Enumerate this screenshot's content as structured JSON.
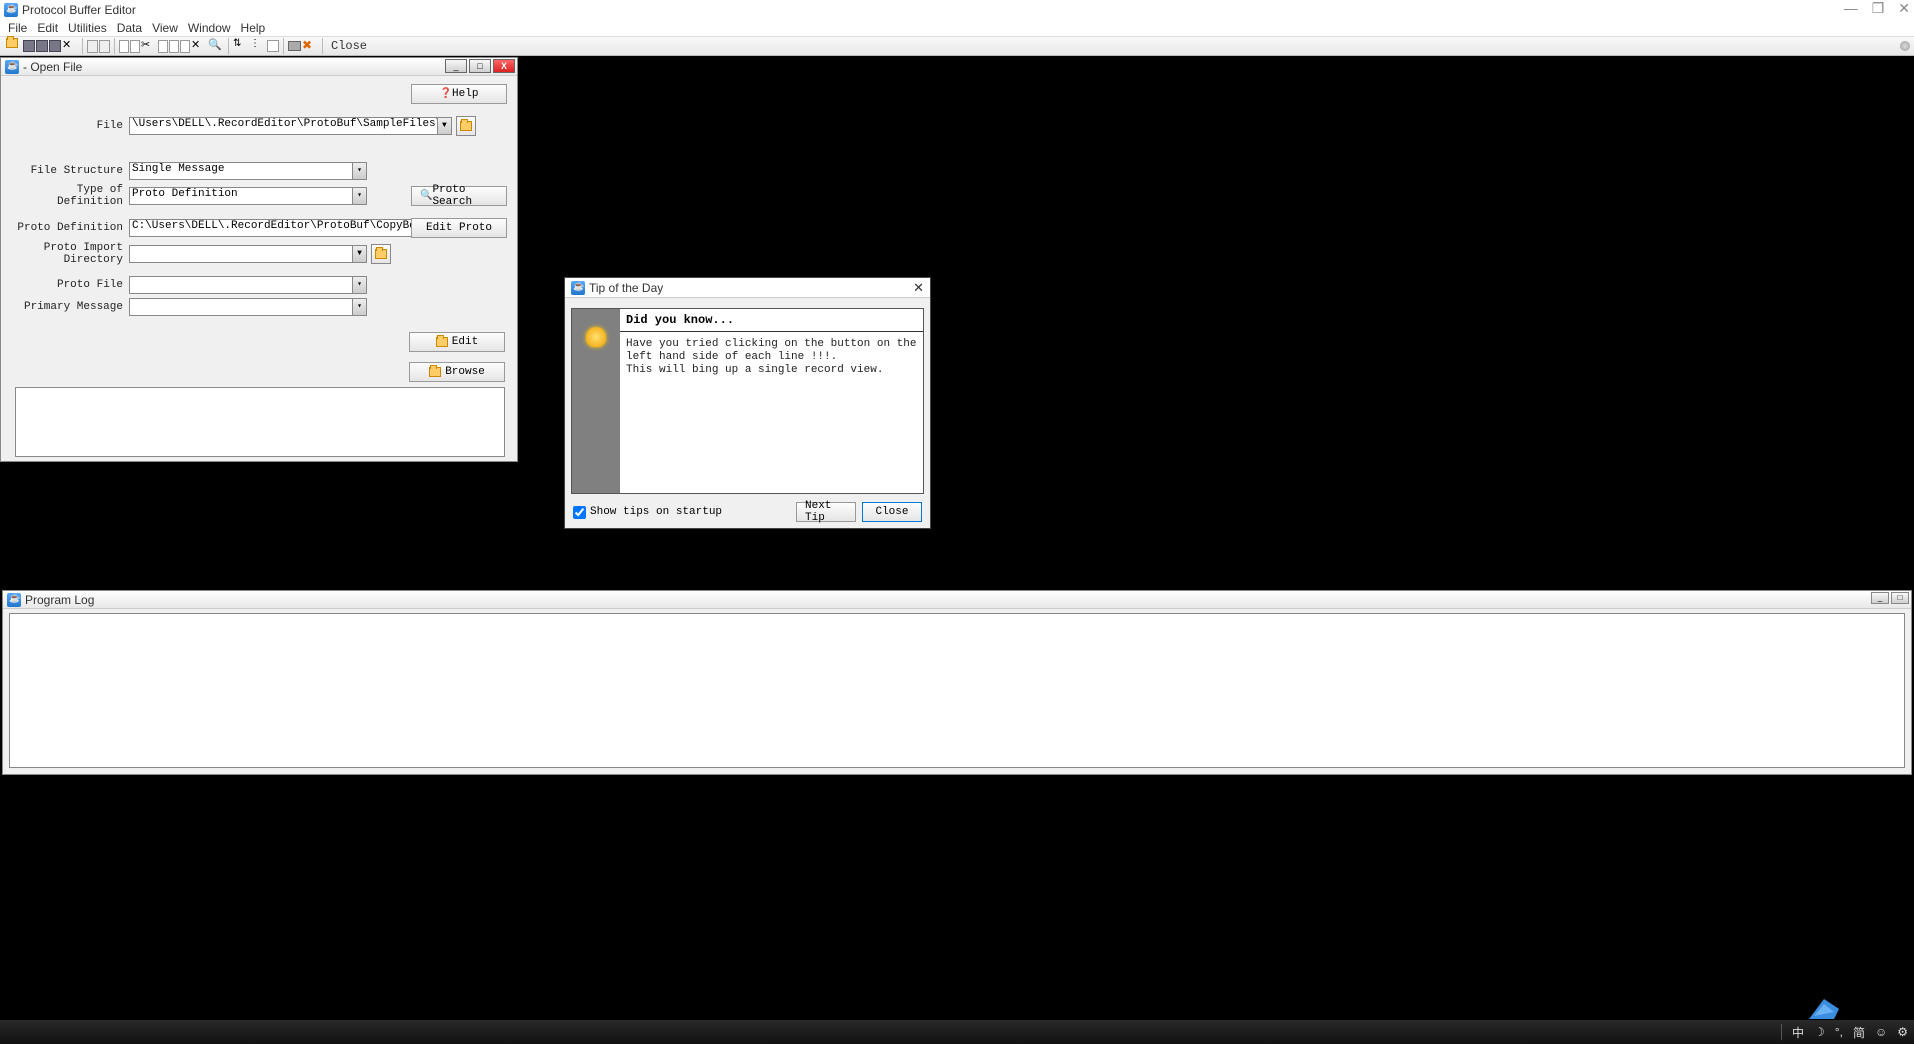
{
  "app": {
    "title": "Protocol Buffer Editor"
  },
  "menu": {
    "file": "File",
    "edit": "Edit",
    "utilities": "Utilities",
    "data": "Data",
    "view": "View",
    "window": "Window",
    "help": "Help"
  },
  "toolbar": {
    "close": "Close"
  },
  "open_file": {
    "title": " - Open File",
    "help": "Help",
    "labels": {
      "file": "File",
      "file_structure": "File Structure",
      "type_of_def": "Type of Definition",
      "proto_def": "Proto Definition",
      "proto_import": "Proto Import Directory",
      "proto_file": "Proto File",
      "primary_msg": "Primary Message"
    },
    "values": {
      "file": "\\Users\\DELL\\.RecordEditor\\ProtoBuf\\SampleFiles\\*",
      "file_structure": "Single Message",
      "type_of_def": "Proto Definition",
      "proto_def": "C:\\Users\\DELL\\.RecordEditor\\ProtoBuf\\CopyBook\\*",
      "proto_import": "",
      "proto_file": "",
      "primary_msg": ""
    },
    "buttons": {
      "proto_search": "Proto Search",
      "edit_proto": "Edit Proto",
      "edit": "Edit",
      "browse": "Browse"
    }
  },
  "tip": {
    "title": "Tip of the Day",
    "header": "Did you know...",
    "body_line1": "Have you tried clicking on the button on the left hand side of each line !!!.",
    "body_line2": "This will bing up a single record view.",
    "show_on_startup": "Show tips on startup",
    "next_tip": "Next Tip",
    "close": "Close"
  },
  "program_log": {
    "title": "Program Log"
  },
  "tray": {
    "ime1": "中",
    "moon": "☽",
    "deg": "°,",
    "ime2": "简",
    "face": "☺",
    "gear": "⚙"
  }
}
